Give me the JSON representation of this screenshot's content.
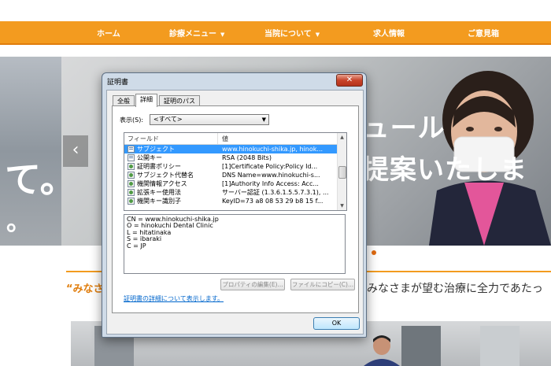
{
  "site": {
    "nav": [
      {
        "label": "ホーム",
        "dropdown": false
      },
      {
        "label": "診療メニュー",
        "dropdown": true
      },
      {
        "label": "当院について",
        "dropdown": true
      },
      {
        "label": "求人情報",
        "dropdown": false
      },
      {
        "label": "ご意見箱",
        "dropdown": false
      }
    ],
    "hero_left_glyph_1": "て。",
    "hero_left_glyph_2": "。",
    "hero_text_1": "ジュール",
    "hero_text_2": "提案いたしま",
    "hero_prev_arrow": "‹",
    "quote_mark": "“みなさ",
    "quote_text": "みなさまが望む治療に全力であたっ",
    "colors": {
      "nav": "#f39b1f",
      "accent": "#e07d0c"
    }
  },
  "dialog": {
    "title": "証明書",
    "close_label": "✕",
    "tabs": [
      {
        "label": "全般",
        "active": false
      },
      {
        "label": "詳細",
        "active": true
      },
      {
        "label": "証明のパス",
        "active": false
      }
    ],
    "show_label": "表示(S):",
    "show_value": "<すべて>",
    "columns": {
      "field": "フィールド",
      "value": "値"
    },
    "rows": [
      {
        "field": "サブジェクト",
        "value": "www.hinokuchi-shika.jp, hinok...",
        "selected": true
      },
      {
        "field": "公開キー",
        "value": "RSA (2048 Bits)",
        "selected": false
      },
      {
        "field": "証明書ポリシー",
        "value": "[1]Certificate Policy:Policy Id...",
        "selected": false
      },
      {
        "field": "サブジェクト代替名",
        "value": "DNS Name=www.hinokuchi-s...",
        "selected": false
      },
      {
        "field": "機関情報アクセス",
        "value": "[1]Authority Info Access: Acc...",
        "selected": false
      },
      {
        "field": "拡張キー使用法",
        "value": "サーバー認証 (1.3.6.1.5.5.7.3.1), ...",
        "selected": false
      },
      {
        "field": "機関キー識別子",
        "value": "KeyID=73 a8 08 53 29 b8 15 f...",
        "selected": false
      }
    ],
    "detail_lines": [
      "CN = www.hinokuchi-shika.jp",
      "O = hinokuchi Dental Clinic",
      "L = hitatinaka",
      "S = ibaraki",
      "C = JP"
    ],
    "edit_properties_label": "プロパティの編集(E)...",
    "copy_to_file_label": "ファイルにコピー(C)...",
    "learn_more_link": "証明書の詳細について表示します。",
    "ok_label": "OK"
  }
}
